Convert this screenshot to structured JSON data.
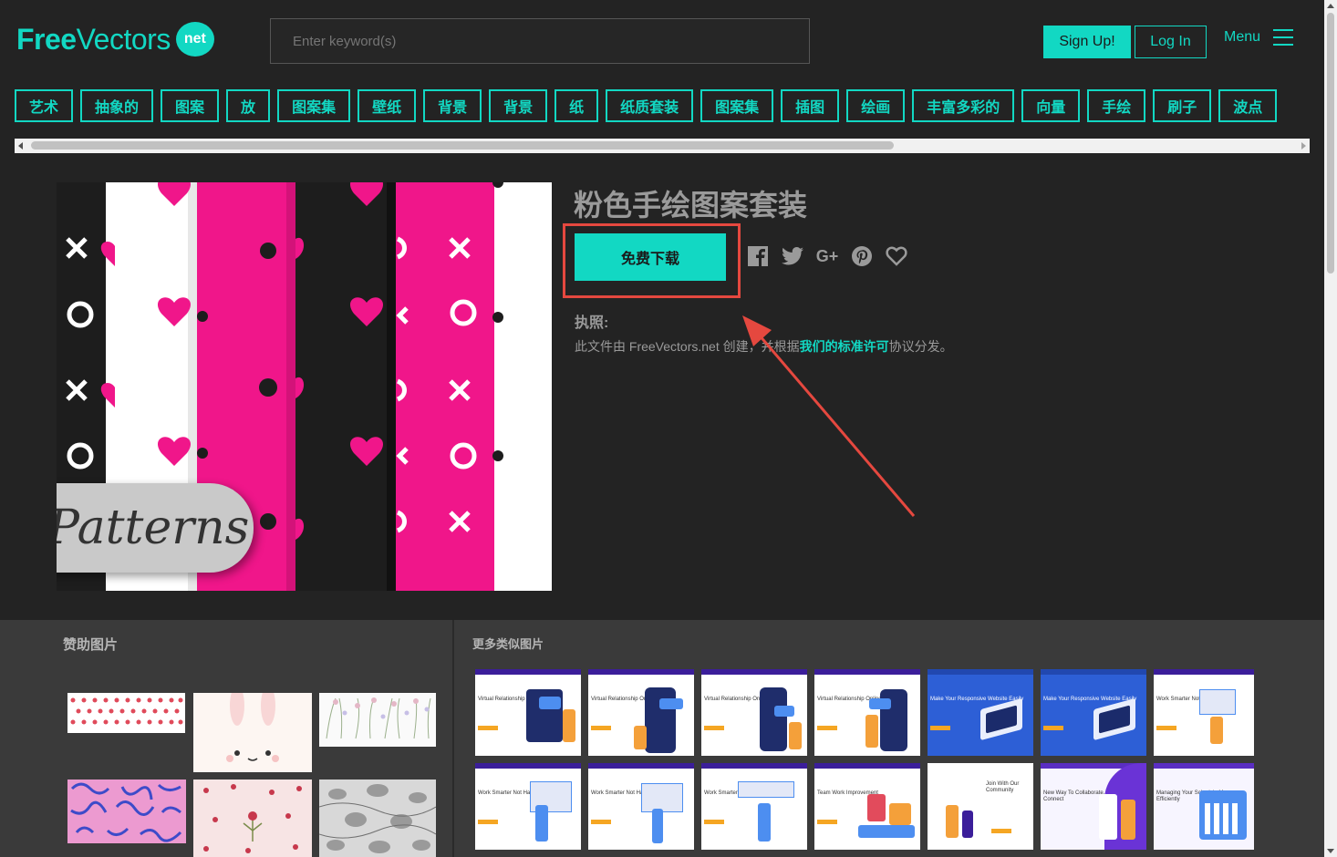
{
  "brand": {
    "logo_free": "Free",
    "logo_vectors": "Vectors",
    "logo_net": "net",
    "accent": "#12d8c3"
  },
  "search": {
    "placeholder": "Enter keyword(s)"
  },
  "header": {
    "signup_label": "Sign Up!",
    "login_label": "Log In",
    "menu_label": "Menu"
  },
  "tags": [
    "艺术",
    "抽象的",
    "图案",
    "放",
    "图案集",
    "壁纸",
    "背景",
    "背景",
    "纸",
    "纸质套装",
    "图案集",
    "插图",
    "绘画",
    "丰富多彩的",
    "向量",
    "手绘",
    "刷子",
    "波点"
  ],
  "preview": {
    "label": "Patterns",
    "colors": {
      "pink": "#f0168a",
      "black": "#1d1d1d",
      "white": "#ffffff"
    }
  },
  "detail": {
    "title": "粉色手绘图案套装",
    "download_label": "免费下载",
    "social_icons": [
      "facebook-icon",
      "twitter-icon",
      "google-plus-icon",
      "pinterest-icon",
      "heart-icon"
    ],
    "license_heading": "执照:",
    "license_text_before": "此文件由 FreeVectors.net 创建，并根据",
    "license_link": "我们的标准许可",
    "license_text_after": "协议分发。",
    "annotation_color": "#e5483f"
  },
  "sponsored": {
    "title": "赞助图片"
  },
  "similar": {
    "title": "更多类似图片",
    "items_row1": [
      "Virtual Relationship Online Dating",
      "Virtual Relationship Online Dating",
      "Virtual Relationship Online Dating",
      "Virtual Relationship Online Dating",
      "Make Your Responsive Website Easily",
      "Make Your Responsive Website Easily",
      "Work Smarter Not Harder"
    ],
    "items_row2": [
      "Work Smarter Not Harder",
      "Work Smarter Not Harder",
      "Work Smarter Not Harder",
      "Team Work Improvement",
      "Join With Our Community",
      "New Way To Collaborate, Contribute and Connect",
      "Managing Your Schedule More Efficiently"
    ]
  }
}
